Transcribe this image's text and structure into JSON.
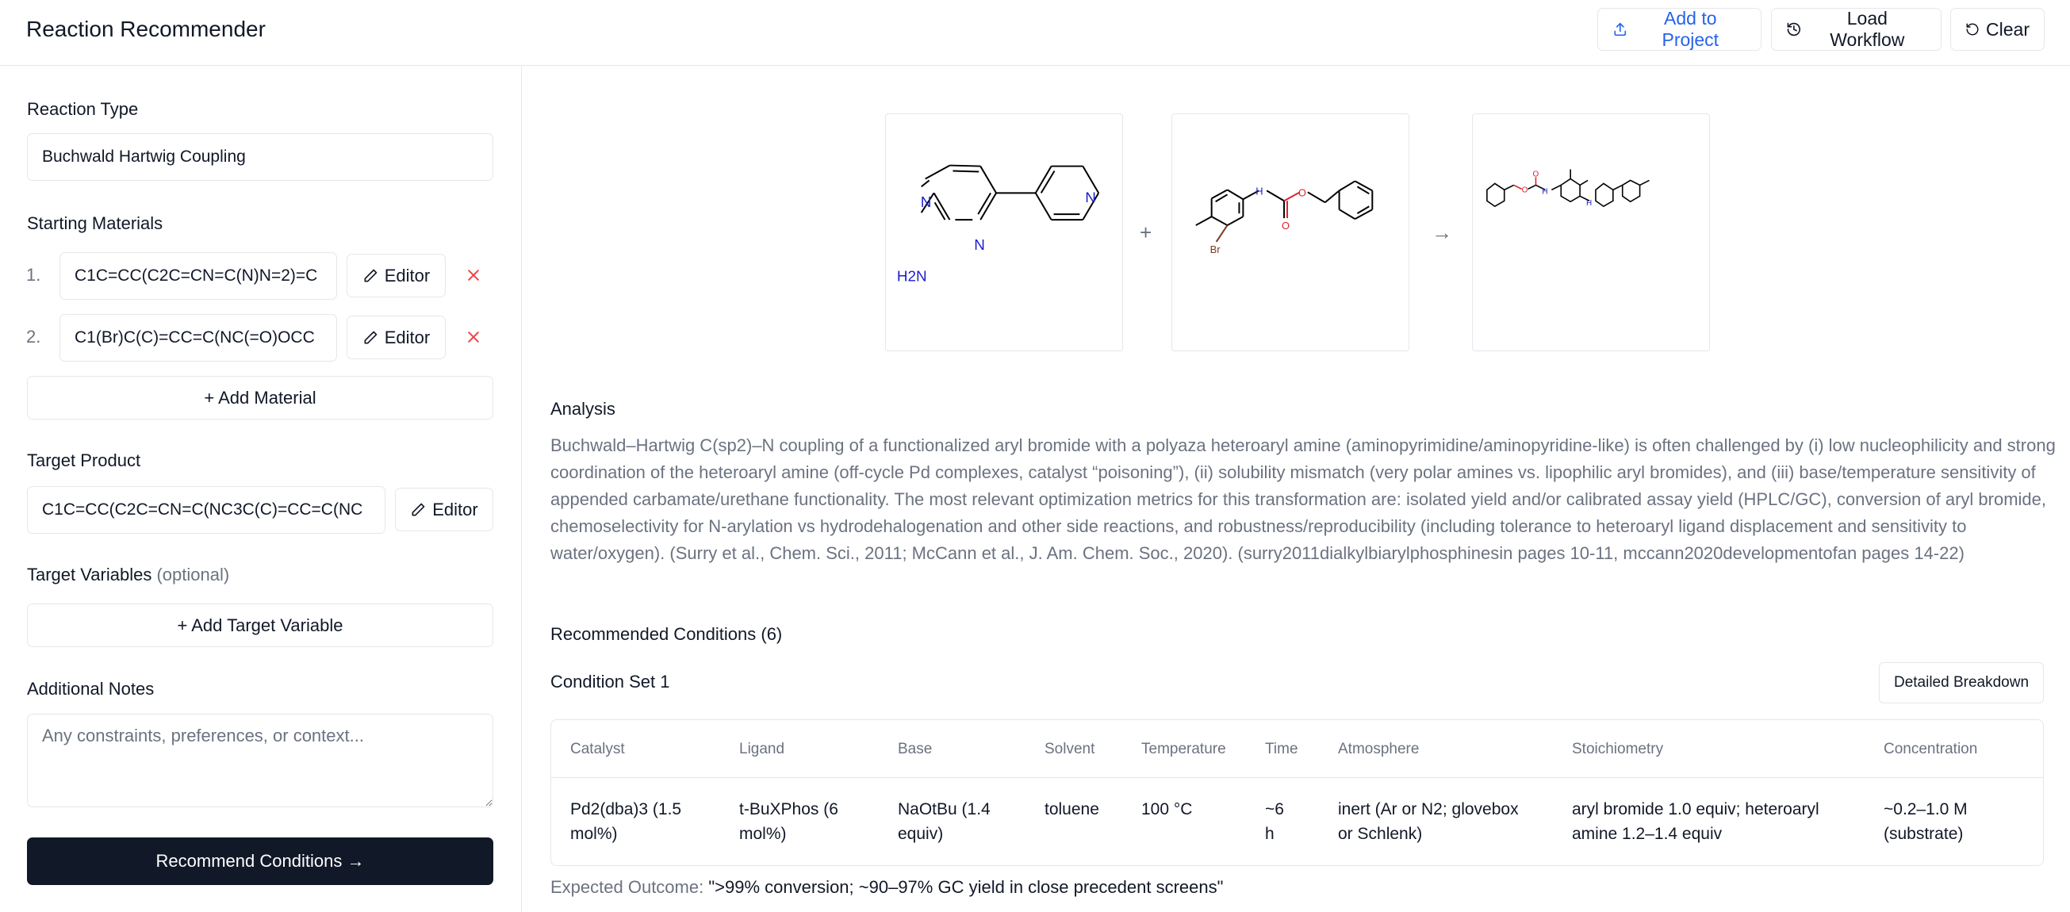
{
  "header": {
    "title": "Reaction Recommender",
    "add_to_project": "Add to Project",
    "load_workflow": "Load Workflow",
    "clear": "Clear",
    "accent": "#2563eb"
  },
  "sidebar": {
    "reaction_type_label": "Reaction Type",
    "reaction_type_value": "Buchwald Hartwig Coupling",
    "starting_materials_label": "Starting Materials",
    "materials": [
      {
        "index": "1.",
        "smiles": "C1C=CC(C2C=CN=C(N)N=2)=C",
        "editor": "Editor"
      },
      {
        "index": "2.",
        "smiles": "C1(Br)C(C)=CC=C(NC(=O)OCC",
        "editor": "Editor"
      }
    ],
    "add_material": "+ Add Material",
    "target_product_label": "Target Product",
    "target_product_value": "C1C=CC(C2C=CN=C(NC3C(C)=CC=C(NC",
    "target_product_editor": "Editor",
    "target_variables_label": "Target Variables",
    "target_variables_optional": "(optional)",
    "add_target_variable": "+ Add Target Variable",
    "additional_notes_label": "Additional Notes",
    "notes_placeholder": "Any constraints, preferences, or context...",
    "recommend_button": "Recommend Conditions →"
  },
  "main": {
    "reaction": {
      "plus": "+",
      "arrow": "→",
      "atom_labels": {
        "N": "N",
        "H2N": "H2N",
        "NH": "H",
        "Br": "Br",
        "O": "O"
      }
    },
    "analysis_title": "Analysis",
    "analysis_text": "Buchwald–Hartwig C(sp2)–N coupling of a functionalized aryl bromide with a polyaza heteroaryl amine (aminopyrimidine/aminopyridine-like) is often challenged by (i) low nucleophilicity and strong coordination of the heteroaryl amine (off-cycle Pd complexes, catalyst “poisoning”), (ii) solubility mismatch (very polar amines vs. lipophilic aryl bromides), and (iii) base/temperature sensitivity of appended carbamate/urethane functionality. The most relevant optimization metrics for this transformation are: isolated yield and/or calibrated assay yield (HPLC/GC), conversion of aryl bromide, chemoselectivity for N-arylation vs hydrodehalogenation and other side reactions, and robustness/reproducibility (including tolerance to heteroaryl ligand displacement and sensitivity to water/oxygen). (Surry et al., Chem. Sci., 2011; McCann et al., J. Am. Chem. Soc., 2020). (surry2011dialkylbiarylphosphinesin pages 10-11, mccann2020developmentofan pages 14-22)",
    "recommended_title": "Recommended Conditions (6)",
    "condition_set_title": "Condition Set 1",
    "detailed_breakdown": "Detailed Breakdown",
    "table": {
      "headers": [
        "Catalyst",
        "Ligand",
        "Base",
        "Solvent",
        "Temperature",
        "Time",
        "Atmosphere",
        "Stoichiometry",
        "Concentration"
      ],
      "row": [
        [
          "Pd2(dba)3 (1.5",
          "mol%)"
        ],
        [
          "t-BuXPhos (6",
          "mol%)"
        ],
        [
          "NaOtBu (1.4",
          "equiv)"
        ],
        [
          "toluene",
          ""
        ],
        [
          "100 °C",
          ""
        ],
        [
          "~6",
          "h"
        ],
        [
          "inert (Ar or N2; glovebox",
          "or Schlenk)"
        ],
        [
          "aryl bromide 1.0 equiv; heteroaryl",
          "amine 1.2–1.4 equiv"
        ],
        [
          "~0.2–1.0 M",
          "(substrate)"
        ]
      ]
    },
    "expected_outcome_label": "Expected Outcome:",
    "expected_outcome_value": "\">99% conversion; ~90–97% GC yield in close precedent screens\""
  }
}
